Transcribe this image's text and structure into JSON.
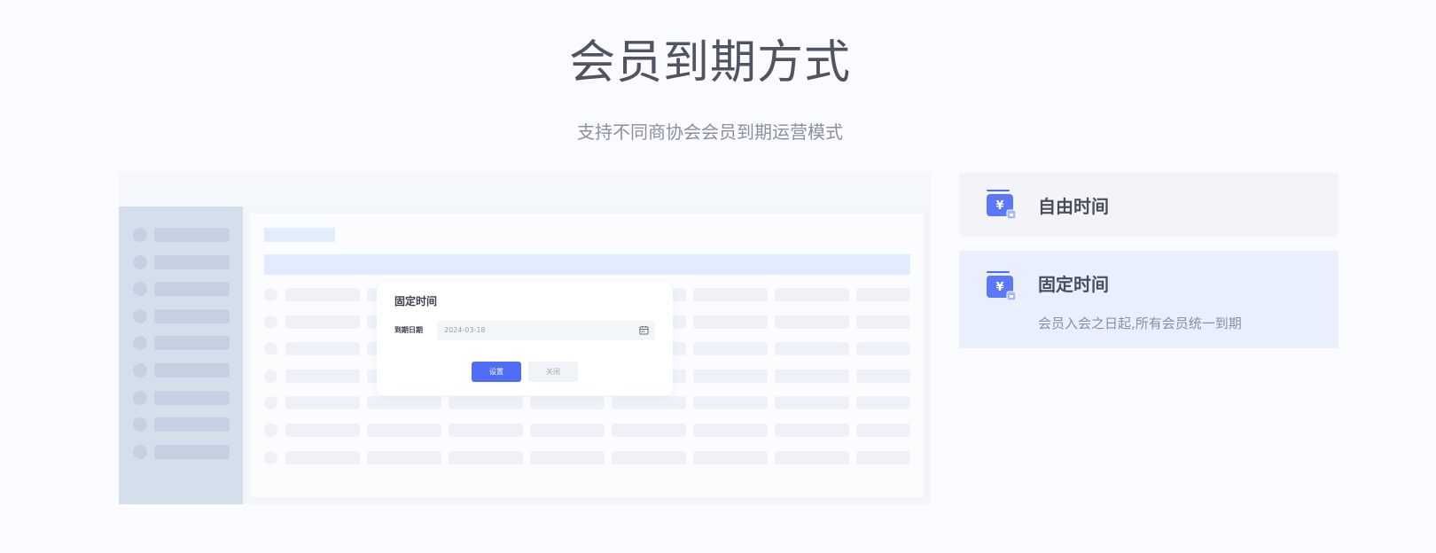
{
  "page": {
    "title": "会员到期方式",
    "subtitle": "支持不同商协会会员到期运营模式"
  },
  "dialog": {
    "title": "固定时间",
    "field_label": "到期日期",
    "date_value": "2024-03-18",
    "confirm_label": "设置",
    "close_label": "关闭"
  },
  "options": [
    {
      "title": "自由时间",
      "description": "",
      "selected": false,
      "icon": "yuan-wallet-icon"
    },
    {
      "title": "固定时间",
      "description": "会员入会之日起,所有会员统一到期",
      "selected": true,
      "icon": "yuan-wallet-icon"
    }
  ],
  "colors": {
    "background": "#f9fbff",
    "accent": "#4f6ef7",
    "selected_card": "#e9effd",
    "card": "#f2f4f8"
  }
}
